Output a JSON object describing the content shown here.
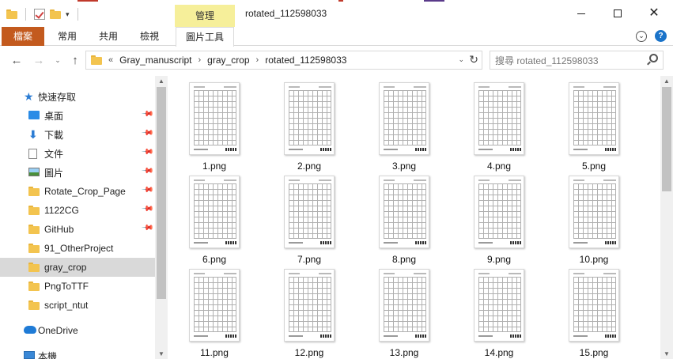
{
  "titlebar": {
    "title": "rotated_112598033",
    "manage_tab": "管理",
    "minimize_glyph": "—",
    "maximize_glyph": "☐",
    "close_glyph": "✕",
    "qat_dropdown_glyph": "▾"
  },
  "ribbon": {
    "tabs": [
      {
        "label": "檔案"
      },
      {
        "label": "常用"
      },
      {
        "label": "共用"
      },
      {
        "label": "檢視"
      },
      {
        "label": "圖片工具"
      }
    ],
    "expand_glyph": "⌄",
    "help_glyph": "?"
  },
  "nav": {
    "back_glyph": "←",
    "forward_glyph": "→",
    "recent_glyph": "⌄",
    "up_glyph": "↑"
  },
  "address": {
    "overflow": "«",
    "crumbs": [
      "Gray_manuscript",
      "gray_crop",
      "rotated_112598033"
    ],
    "separator": "›",
    "dropdown_glyph": "⌄",
    "refresh_glyph": "↻"
  },
  "search": {
    "placeholder": "搜尋 rotated_112598033"
  },
  "navpane": {
    "quick_access": "快速存取",
    "items": [
      {
        "label": "桌面",
        "icon": "desktop-icon",
        "pinned": true
      },
      {
        "label": "下載",
        "icon": "download-icon",
        "pinned": true
      },
      {
        "label": "文件",
        "icon": "document-icon",
        "pinned": true
      },
      {
        "label": "圖片",
        "icon": "picture-icon",
        "pinned": true
      },
      {
        "label": "Rotate_Crop_Page",
        "icon": "folder-icon",
        "pinned": true
      },
      {
        "label": "1122CG",
        "icon": "folder-icon",
        "pinned": true
      },
      {
        "label": "GitHub",
        "icon": "folder-icon",
        "pinned": true
      },
      {
        "label": "91_OtherProject",
        "icon": "folder-icon",
        "pinned": false
      },
      {
        "label": "gray_crop",
        "icon": "folder-icon",
        "pinned": false,
        "selected": true
      },
      {
        "label": "PngToTTF",
        "icon": "folder-icon",
        "pinned": false
      },
      {
        "label": "script_ntut",
        "icon": "folder-icon",
        "pinned": false
      }
    ],
    "onedrive": "OneDrive",
    "this_pc": "本機",
    "pin_glyph": "📌",
    "star_glyph": "★",
    "down_glyph": "⬇"
  },
  "scroll": {
    "up_glyph": "▲",
    "down_glyph": "▼"
  },
  "files": [
    "1.png",
    "2.png",
    "3.png",
    "4.png",
    "5.png",
    "6.png",
    "7.png",
    "8.png",
    "9.png",
    "10.png",
    "11.png",
    "12.png",
    "13.png",
    "14.png",
    "15.png"
  ]
}
